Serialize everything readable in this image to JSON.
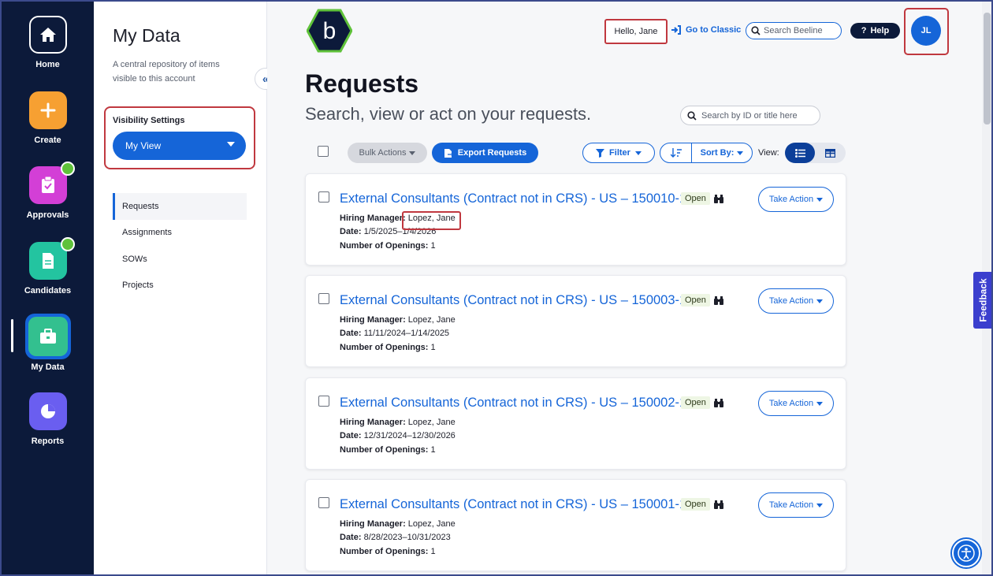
{
  "rail": {
    "items": [
      {
        "label": "Home",
        "icon": "home-icon",
        "color": "#0c1a3a"
      },
      {
        "label": "Create",
        "icon": "plus-icon",
        "color": "#f6a032"
      },
      {
        "label": "Approvals",
        "icon": "clipboard-check-icon",
        "color": "#d33fd6"
      },
      {
        "label": "Candidates",
        "icon": "document-icon",
        "color": "#23c4a0"
      },
      {
        "label": "My Data",
        "icon": "briefcase-icon",
        "color": "#33c08f"
      },
      {
        "label": "Reports",
        "icon": "pie-chart-icon",
        "color": "#6a5ef0"
      }
    ]
  },
  "panel": {
    "title": "My Data",
    "description": "A central repository of items visible to this account",
    "visibility_label": "Visibility Settings",
    "visibility_value": "My View",
    "nav": [
      {
        "label": "Requests",
        "active": true
      },
      {
        "label": "Assignments",
        "active": false
      },
      {
        "label": "SOWs",
        "active": false
      },
      {
        "label": "Projects",
        "active": false
      }
    ]
  },
  "header": {
    "logo_letter": "b",
    "greeting": "Hello, Jane",
    "classic_link": "Go to Classic",
    "search_placeholder": "Search Beeline",
    "help_label": "Help",
    "avatar_initials": "JL"
  },
  "main": {
    "title": "Requests",
    "subtitle": "Search, view or act on your requests.",
    "search_placeholder": "Search by ID or title here",
    "bulk_actions": "Bulk Actions",
    "export": "Export Requests",
    "filter": "Filter",
    "sort": "Sort By:",
    "view_label": "View:",
    "hiring_manager_label": "Hiring Manager:",
    "date_label": "Date:",
    "openings_label": "Number of Openings:",
    "take_action": "Take Action",
    "requests": [
      {
        "title": "External Consultants (Contract not in CRS) - US – 150010-1",
        "status": "Open",
        "manager": "Lopez, Jane",
        "date": "1/5/2025–1/4/2026",
        "openings": "1"
      },
      {
        "title": "External Consultants (Contract not in CRS) - US – 150003-1",
        "status": "Open",
        "manager": "Lopez, Jane",
        "date": "11/11/2024–1/14/2025",
        "openings": "1"
      },
      {
        "title": "External Consultants (Contract not in CRS) - US – 150002-1",
        "status": "Open",
        "manager": "Lopez, Jane",
        "date": "12/31/2024–12/30/2026",
        "openings": "1"
      },
      {
        "title": "External Consultants (Contract not in CRS) - US – 150001-1",
        "status": "Open",
        "manager": "Lopez, Jane",
        "date": "8/28/2023–10/31/2023",
        "openings": "1"
      }
    ]
  },
  "feedback_label": "Feedback",
  "colors": {
    "brand": "#1565d8",
    "rail": "#0c1a3a",
    "highlight": "#c0383f"
  }
}
